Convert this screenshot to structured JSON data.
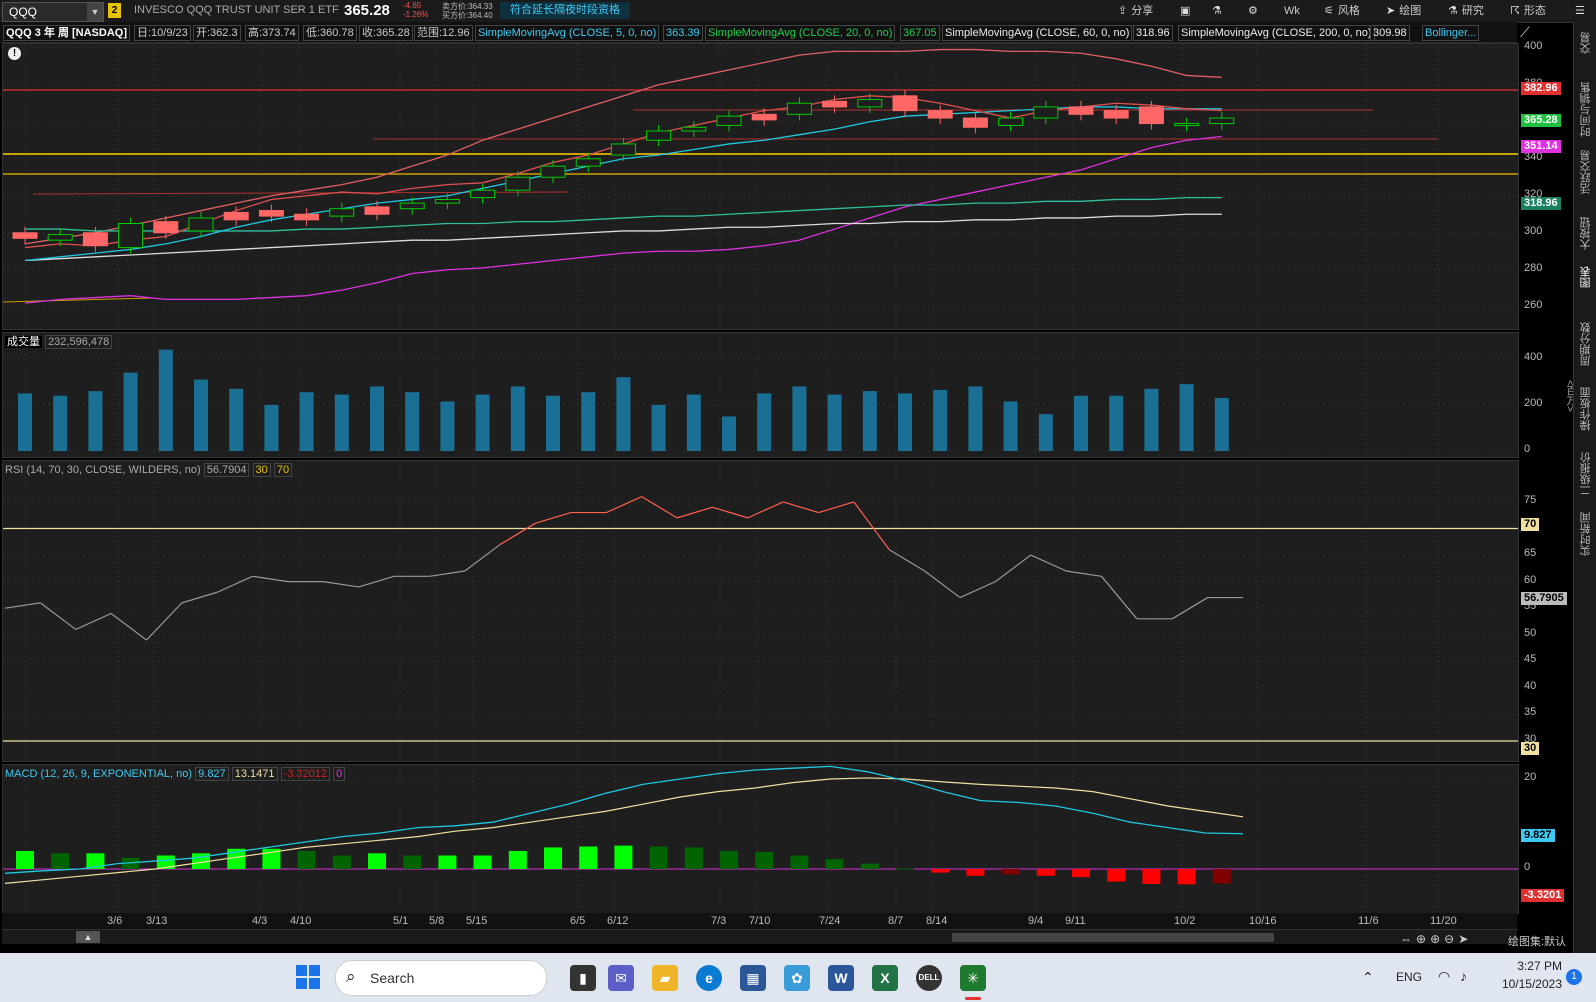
{
  "header": {
    "symbol": "QQQ",
    "link_badge": "2",
    "description": "INVESCO QQQ TRUST UNIT SER 1 ETF",
    "last": "365.28",
    "change": "-4.65",
    "change_pct": "-1.26%",
    "ask": "卖方价:364.33",
    "bid": "买方价:364.40",
    "ext_hours_btn": "符合延长隔夜时段资格",
    "toolbar": {
      "share": "分享",
      "grid": "",
      "flask": "",
      "settings": "",
      "period": "Wk",
      "style": "风格",
      "draw": "绘图",
      "research": "研究",
      "pattern": "形态"
    }
  },
  "studies": {
    "chart_label": "QQQ 3 年 周 [NASDAQ]",
    "date": "日:10/9/23",
    "open": "开:362.3",
    "high": "高:373.74",
    "low": "低:360.78",
    "close": "收:365.28",
    "range": "范围:12.96",
    "sma5": "SimpleMovingAvg (CLOSE, 5, 0, no)",
    "sma5_val": "363.39",
    "sma20": "SimpleMovingAvg (CLOSE, 20, 0, no)",
    "sma20_val": "367.05",
    "sma60": "SimpleMovingAvg (CLOSE, 60, 0, no)",
    "sma60_val": "318.96",
    "sma200": "SimpleMovingAvg (CLOSE, 200, 0, no)",
    "sma200_val": "309.98",
    "bollinger": "Bollinger..."
  },
  "price_pane": {
    "ticks": [
      "400",
      "380",
      "360",
      "340",
      "320",
      "300",
      "280",
      "260"
    ],
    "tags": {
      "upper": "382.96",
      "last": "365.28",
      "sma": "351.14",
      "sma60": "318.96"
    }
  },
  "volume_pane": {
    "title": "成交量",
    "value": "232,596,478",
    "ticks": [
      "400",
      "200",
      "0"
    ],
    "unit": "<百万>",
    "bars": [
      250,
      240,
      260,
      340,
      440,
      310,
      270,
      200,
      255,
      245,
      280,
      255,
      215,
      245,
      280,
      240,
      255,
      320,
      200,
      245,
      150,
      250,
      280,
      245,
      260,
      250,
      265,
      280,
      215,
      160,
      240,
      240,
      270,
      290,
      230
    ]
  },
  "rsi_pane": {
    "title": "RSI (14, 70, 30, CLOSE, WILDERS, no)",
    "value": "56.7904",
    "os": "30",
    "ob": "70",
    "ticks": [
      "75",
      "70",
      "65",
      "60",
      "55",
      "50",
      "45",
      "40",
      "35",
      "30"
    ],
    "tag_last": "56.7905",
    "tag_ob": "70",
    "tag_os": "30",
    "values": [
      55,
      56,
      51,
      54,
      49,
      56,
      58,
      61,
      60,
      60,
      59,
      61,
      61,
      62,
      67,
      71,
      73,
      73,
      76,
      72,
      74,
      72,
      75,
      73,
      75,
      66,
      62,
      57,
      60,
      65,
      62,
      61,
      53,
      53,
      57,
      57
    ]
  },
  "macd_pane": {
    "title": "MACD (12, 26, 9, EXPONENTIAL, no)",
    "value": "9.827",
    "avg": "13.1471",
    "diff": "-3.32012",
    "zero": "0",
    "ticks": [
      "20",
      "0"
    ],
    "tag_value": "9.827",
    "tag_diff": "-3.3201",
    "hist": [
      4,
      3.5,
      3.5,
      2.5,
      3,
      3.5,
      4.5,
      4.5,
      4,
      3,
      3.5,
      3,
      3,
      3,
      4,
      4.8,
      5,
      5.2,
      5,
      4.8,
      4,
      3.8,
      3,
      2.2,
      1.2,
      0.1,
      -0.8,
      -1.5,
      -1.2,
      -1.5,
      -1.8,
      -2.8,
      -3.3,
      -3.4,
      -3.2
    ],
    "macd": [
      -1.2,
      -0.5,
      0,
      1.5,
      2.2,
      3,
      4.5,
      6,
      7.5,
      9,
      10,
      11.5,
      12,
      13,
      15.5,
      18,
      21,
      23.5,
      25,
      26.5,
      27.5,
      28,
      28.5,
      27,
      24.5,
      21.5,
      19,
      18.5,
      17.5,
      15.5,
      13,
      11.5,
      10,
      9.8
    ],
    "signal": [
      -4,
      -3,
      -2,
      -1,
      0,
      1.5,
      3,
      4.5,
      6,
      7,
      8,
      9,
      10.5,
      11.5,
      13,
      14.5,
      16,
      18,
      20,
      21.5,
      22.5,
      24,
      25,
      25.3,
      25,
      24.2,
      23.5,
      23,
      22.5,
      21.5,
      19.5,
      17.5,
      16,
      14.5
    ]
  },
  "x_axis": [
    "3/6",
    "3/13",
    "4/3",
    "4/10",
    "5/1",
    "5/8",
    "5/15",
    "6/5",
    "6/12",
    "7/3",
    "7/10",
    "7/24",
    "8/7",
    "8/14",
    "9/4",
    "9/11",
    "10/2",
    "10/16",
    "11/6",
    "11/20"
  ],
  "bottom_bar": {
    "study_set": "绘图集:默认"
  },
  "right_tabs": [
    "交易",
    "时间与销售",
    "活跃交易",
    "大按钮",
    "图表",
    "周期分数",
    "操作板面",
    "二级报价",
    "实时新闻"
  ],
  "taskbar": {
    "search": "Search",
    "lang": "ENG",
    "time": "3:27 PM",
    "date": "10/15/2023",
    "badge": "1"
  },
  "colors": {
    "bull": "#00cc00",
    "bear": "#ff6666",
    "accent": "#3ec9f2",
    "macd_hist_pos": "#00ff00",
    "macd_hist_neg": "#ff0000"
  }
}
